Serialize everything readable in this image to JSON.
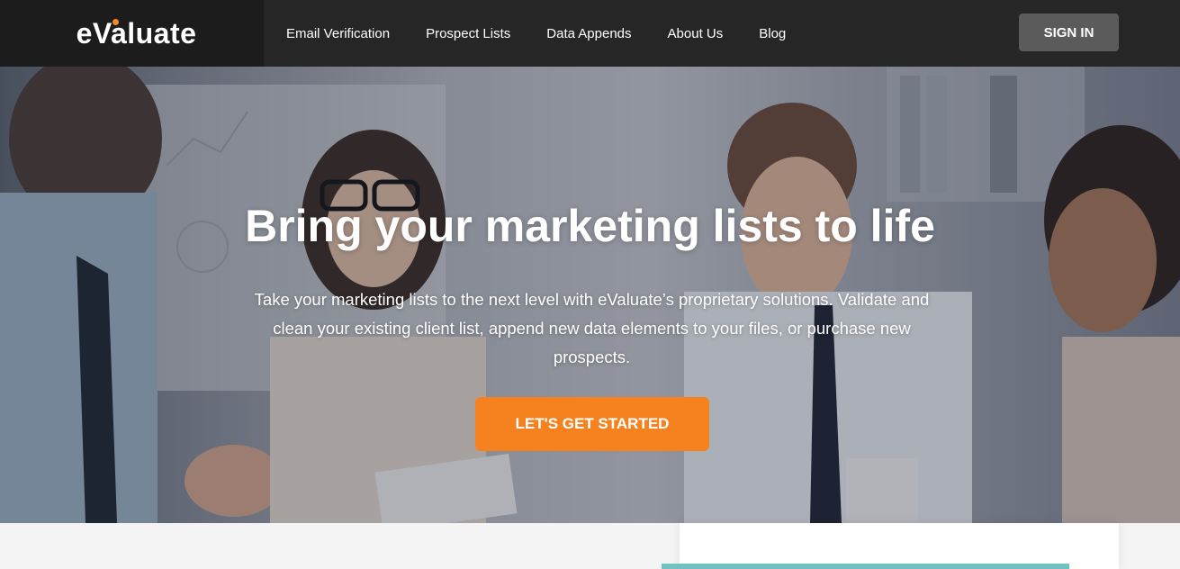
{
  "nav": {
    "brand": "eValuate",
    "links": [
      "Email Verification",
      "Prospect Lists",
      "Data Appends",
      "About Us",
      "Blog"
    ],
    "sign_in": "SIGN IN"
  },
  "hero": {
    "title": "Bring your marketing lists to life",
    "subtitle": "Take your marketing lists to the next level with eValuate’s proprietary solutions. Validate and clean your existing client list, append new data elements to your files, or purchase new prospects.",
    "cta": "LET'S GET STARTED"
  },
  "colors": {
    "nav_bg": "#262626",
    "brand_accent": "#f58a1f",
    "cta_bg": "#f5821f",
    "signin_bg": "#5b5b5b",
    "teal_accent": "#6fc3c0"
  }
}
